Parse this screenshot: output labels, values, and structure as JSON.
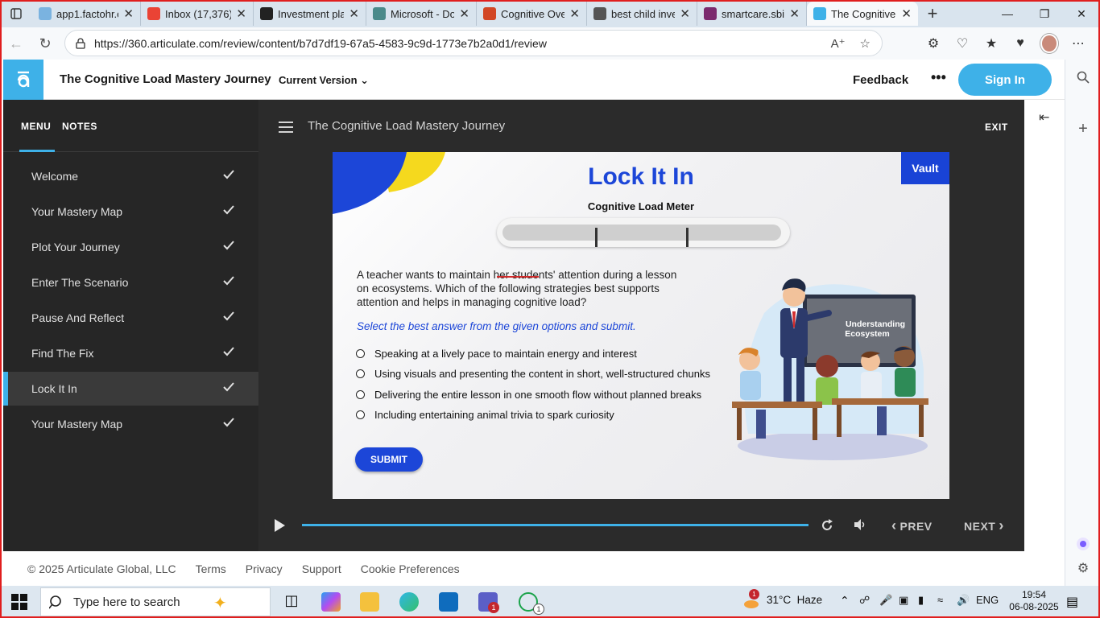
{
  "browser": {
    "tabs": [
      {
        "title": "app1.factohr.c",
        "active": false,
        "fav_color": "#7ab3e0"
      },
      {
        "title": "Inbox (17,376)",
        "active": false,
        "fav_color": "#ea4335"
      },
      {
        "title": "Investment pla",
        "active": false,
        "fav_color": "#222222"
      },
      {
        "title": "Microsoft - Do",
        "active": false,
        "fav_color": "#4a8a8a"
      },
      {
        "title": "Cognitive Over",
        "active": false,
        "fav_color": "#d24726"
      },
      {
        "title": "best child inve",
        "active": false,
        "fav_color": "#555555"
      },
      {
        "title": "smartcare.sbil",
        "active": false,
        "fav_color": "#7b2a6e"
      },
      {
        "title": "The Cognitive",
        "active": true,
        "fav_color": "#3eb1e8"
      }
    ],
    "url": "https://360.articulate.com/review/content/b7d7df19-67a5-4583-9c9d-1773e7b2a0d1/review"
  },
  "app": {
    "title": "The Cognitive Load Mastery Journey",
    "version_label": "Current Version",
    "feedback_label": "Feedback",
    "more_label": "•••",
    "signin_label": "Sign In"
  },
  "player": {
    "menu_tab": "MENU",
    "notes_tab": "NOTES",
    "title": "The Cognitive Load Mastery Journey",
    "exit_label": "EXIT",
    "menu_items": [
      {
        "label": "Welcome",
        "done": true
      },
      {
        "label": "Your Mastery Map",
        "done": true
      },
      {
        "label": "Plot Your Journey",
        "done": true
      },
      {
        "label": "Enter The Scenario",
        "done": true
      },
      {
        "label": "Pause And Reflect",
        "done": true
      },
      {
        "label": "Find The Fix",
        "done": true
      },
      {
        "label": "Lock It In",
        "done": true,
        "active": true
      },
      {
        "label": "Your Mastery Map",
        "done": true
      }
    ],
    "prev_label": "PREV",
    "next_label": "NEXT",
    "progress": 1.0
  },
  "slide": {
    "vault_label": "Vault",
    "title": "Lock It In",
    "meter_label": "Cognitive Load Meter",
    "question_lines": [
      "A teacher wants to maintain her students' attention during a lesson",
      "on ecosystems. Which of the following strategies best supports",
      "attention and helps in managing cognitive load?"
    ],
    "instruction": "Select the best answer from the given options and submit.",
    "options": [
      "Speaking at a lively pace to maintain energy and interest",
      "Using visuals and presenting the content in short, well-structured chunks",
      "Delivering the entire lesson in one smooth flow without planned breaks",
      "Including entertaining animal trivia to spark curiosity"
    ],
    "submit_label": "SUBMIT",
    "board_text_1": "Understanding",
    "board_text_2": "Ecosystem"
  },
  "footer": {
    "copyright": "© 2025 Articulate Global, LLC",
    "links": [
      "Terms",
      "Privacy",
      "Support",
      "Cookie Preferences"
    ]
  },
  "taskbar": {
    "search_placeholder": "Type here to search",
    "weather": "31°C  Haze",
    "language": "ENG",
    "time": "19:54",
    "date": "06-08-2025",
    "teams_badge": "1",
    "whatsapp_badge": "1",
    "weather_badge": "1"
  }
}
